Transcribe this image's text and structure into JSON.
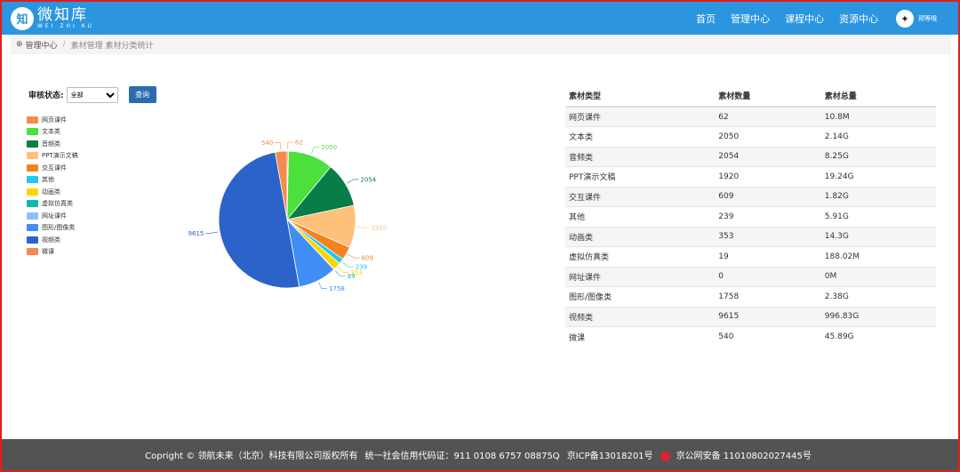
{
  "header": {
    "logo_mark": "知",
    "logo_title": "微知库",
    "logo_sub": "WEI ZHI KU",
    "nav": [
      "首页",
      "管理中心",
      "课程中心",
      "资源中心"
    ],
    "username": "预等哦"
  },
  "breadcrumb": {
    "home": "管理中心",
    "current": "素材管理 素材分类统计"
  },
  "filter": {
    "label": "审核状态:",
    "selected": "全部",
    "button": "查询"
  },
  "table": {
    "headers": [
      "素材类型",
      "素材数量",
      "素材总量"
    ],
    "rows": [
      [
        "网页课件",
        "62",
        "10.8M"
      ],
      [
        "文本类",
        "2050",
        "2.14G"
      ],
      [
        "音频类",
        "2054",
        "8.25G"
      ],
      [
        "PPT演示文稿",
        "1920",
        "19.24G"
      ],
      [
        "交互课件",
        "609",
        "1.82G"
      ],
      [
        "其他",
        "239",
        "5.91G"
      ],
      [
        "动画类",
        "353",
        "14.3G"
      ],
      [
        "虚拟仿真类",
        "19",
        "188.02M"
      ],
      [
        "网址课件",
        "0",
        "0M"
      ],
      [
        "图形/图像类",
        "1758",
        "2.38G"
      ],
      [
        "视频类",
        "9615",
        "996.83G"
      ],
      [
        "微课",
        "540",
        "45.89G"
      ]
    ]
  },
  "chart_data": {
    "type": "pie",
    "categories": [
      "网页课件",
      "文本类",
      "音频类",
      "PPT演示文稿",
      "交互课件",
      "其他",
      "动画类",
      "虚拟仿真类",
      "网址课件",
      "图形/图像类",
      "视频类",
      "微课"
    ],
    "values": [
      62,
      2050,
      2054,
      1920,
      609,
      239,
      353,
      19,
      0,
      1758,
      9615,
      540
    ],
    "colors": [
      "#f58b4c",
      "#4be03c",
      "#087d47",
      "#ffc07a",
      "#f5821f",
      "#1ec8f0",
      "#ffd400",
      "#13b7a9",
      "#8cc0f5",
      "#418ef7",
      "#2c63c8",
      "#f58b4c"
    ],
    "legend": "left-top"
  },
  "footer": {
    "copyright": "Copright © 领航未来（北京）科技有限公司版权所有",
    "credit_code": "统一社会信用代码证：911 0108 6757 08875Q",
    "icp": "京ICP备13018201号",
    "police": "京公网安备 11010802027445号"
  }
}
